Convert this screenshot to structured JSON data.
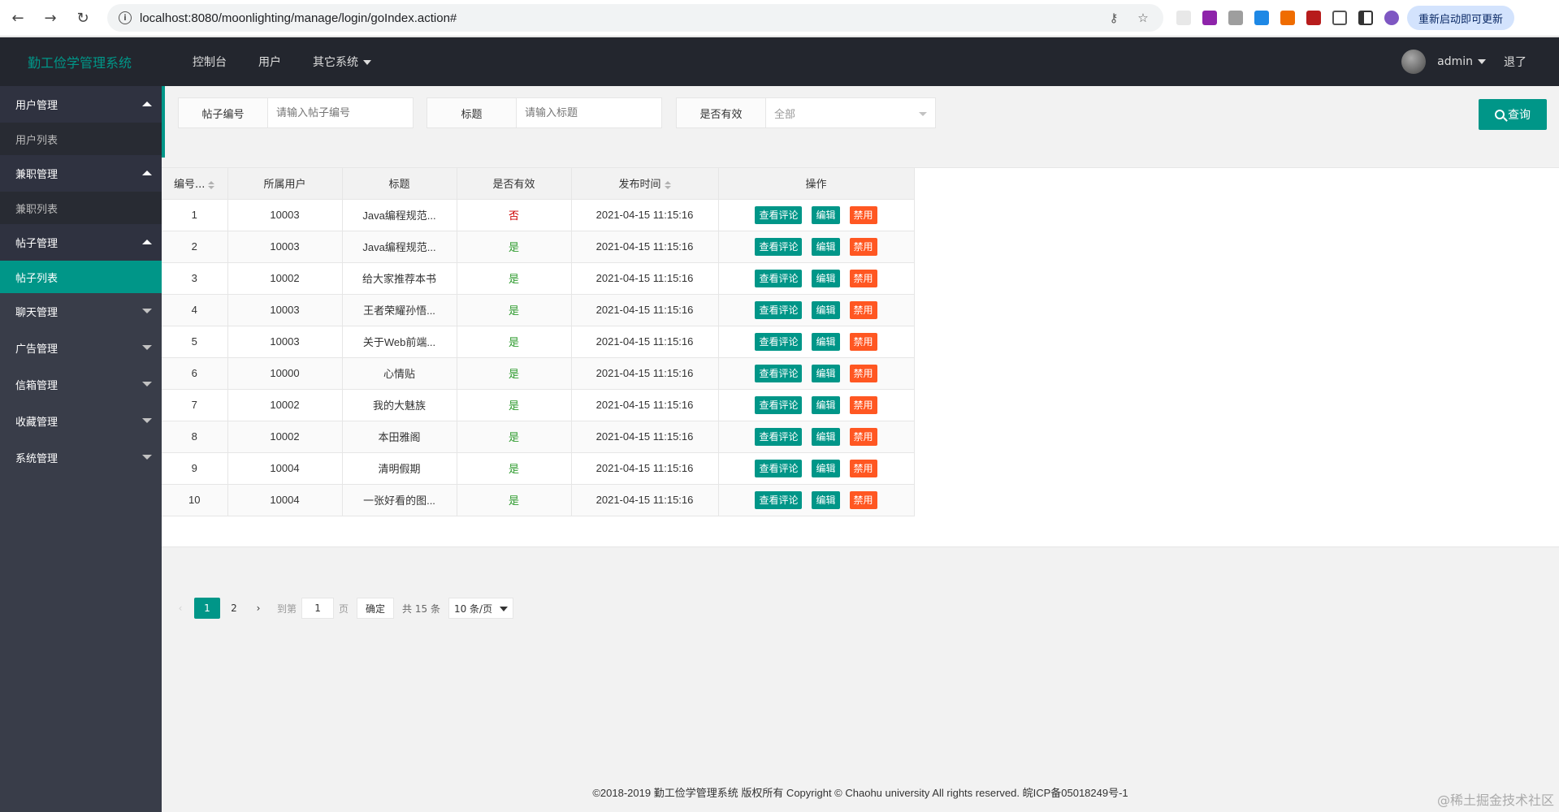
{
  "browser": {
    "url": "localhost:8080/moonlighting/manage/login/goIndex.action#",
    "update_label": "重新启动即可更新"
  },
  "header": {
    "logo": "勤工俭学管理系统",
    "nav": [
      {
        "label": "控制台"
      },
      {
        "label": "用户"
      },
      {
        "label": "其它系统"
      }
    ],
    "user": "admin",
    "logout": "退了"
  },
  "sidebar": {
    "user_mgmt": "用户管理",
    "user_list": "用户列表",
    "job_mgmt": "兼职管理",
    "job_list": "兼职列表",
    "post_mgmt": "帖子管理",
    "post_list": "帖子列表",
    "collapsed": [
      {
        "label": "聊天管理"
      },
      {
        "label": "广告管理"
      },
      {
        "label": "信箱管理"
      },
      {
        "label": "收藏管理"
      },
      {
        "label": "系统管理"
      }
    ]
  },
  "search": {
    "post_id_label": "帖子编号",
    "post_id_placeholder": "请输入帖子编号",
    "title_label": "标题",
    "title_placeholder": "请输入标题",
    "valid_label": "是否有效",
    "valid_value": "全部",
    "query_label": "查询"
  },
  "table": {
    "headers": [
      "编号...",
      "所属用户",
      "标题",
      "是否有效",
      "发布时间",
      "操作"
    ],
    "rows": [
      {
        "id": "1",
        "user": "10003",
        "title": "Java编程规范...",
        "valid": "否",
        "time": "2021-04-15 11:15:16"
      },
      {
        "id": "2",
        "user": "10003",
        "title": "Java编程规范...",
        "valid": "是",
        "time": "2021-04-15 11:15:16"
      },
      {
        "id": "3",
        "user": "10002",
        "title": "给大家推荐本书",
        "valid": "是",
        "time": "2021-04-15 11:15:16"
      },
      {
        "id": "4",
        "user": "10003",
        "title": "王者荣耀孙悟...",
        "valid": "是",
        "time": "2021-04-15 11:15:16"
      },
      {
        "id": "5",
        "user": "10003",
        "title": "关于Web前端...",
        "valid": "是",
        "time": "2021-04-15 11:15:16"
      },
      {
        "id": "6",
        "user": "10000",
        "title": "心情贴",
        "valid": "是",
        "time": "2021-04-15 11:15:16"
      },
      {
        "id": "7",
        "user": "10002",
        "title": "我的大魅族",
        "valid": "是",
        "time": "2021-04-15 11:15:16"
      },
      {
        "id": "8",
        "user": "10002",
        "title": "本田雅阁",
        "valid": "是",
        "time": "2021-04-15 11:15:16"
      },
      {
        "id": "9",
        "user": "10004",
        "title": "清明假期",
        "valid": "是",
        "time": "2021-04-15 11:15:16"
      },
      {
        "id": "10",
        "user": "10004",
        "title": "一张好看的图...",
        "valid": "是",
        "time": "2021-04-15 11:15:16"
      }
    ],
    "op_view": "查看评论",
    "op_edit": "编辑",
    "op_disable": "禁用"
  },
  "pager": {
    "page1": "1",
    "page2": "2",
    "goto": "到第",
    "jump_value": "1",
    "page_unit": "页",
    "ok": "确定",
    "total": "共 15 条",
    "limit": "10 条/页"
  },
  "footer": "©2018-2019 勤工俭学管理系统 版权所有  Copyright © Chaohu university All rights reserved. 皖ICP备05018249号-1",
  "watermark": "@稀土掘金技术社区"
}
